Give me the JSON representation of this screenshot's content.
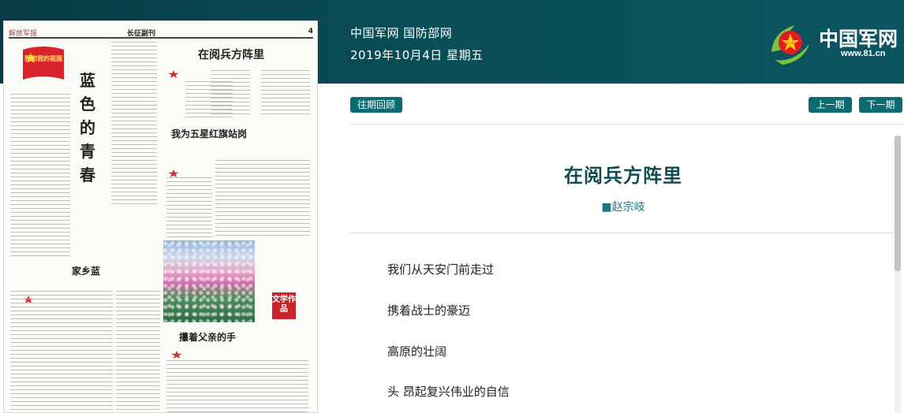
{
  "header": {
    "site_name": "中国军网 国防部网",
    "date": "2019年10月4日 星期五",
    "logo_text": "中国军网",
    "logo_url": "www.81.cn"
  },
  "newspaper": {
    "masthead": "解放军报",
    "section": "长征副刊",
    "page_number": "4",
    "banner": "我和我的祖国",
    "headlines": {
      "main_poem": "在阅兵方阵里",
      "vertical": "蓝色的青春",
      "flag": "我为五星红旗站岗",
      "hometown": "家乡蓝",
      "father": "攥着父亲的手"
    },
    "stamp": "文学作品"
  },
  "nav": {
    "archive_label": "往期回顾",
    "prev_label": "上一期",
    "next_label": "下一期"
  },
  "article": {
    "title": "在阅兵方阵里",
    "author": "■赵宗岐",
    "lines": [
      "我们从天安门前走过",
      "携着战士的豪迈",
      "高原的壮阔",
      "头 昂起复兴伟业的自信"
    ]
  },
  "colors": {
    "header_bg": "#0a4d57",
    "accent": "#0c6b70",
    "title_color": "#114c52"
  }
}
